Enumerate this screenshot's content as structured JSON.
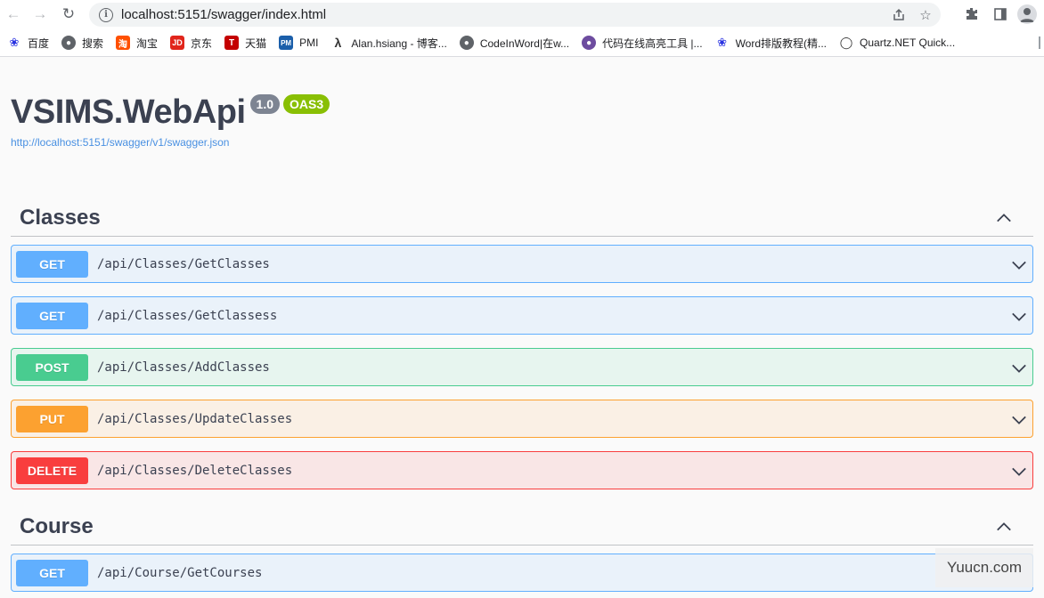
{
  "browser": {
    "url": "localhost:5151/swagger/index.html",
    "bookmarks": [
      {
        "label": "百度",
        "icon": "paw-icon",
        "color": "#2932e1"
      },
      {
        "label": "搜索",
        "icon": "globe-icon",
        "color": "#5f6368"
      },
      {
        "label": "淘宝",
        "icon": "taobao-icon",
        "color": "#ff5000"
      },
      {
        "label": "京东",
        "icon": "jd-icon",
        "color": "#e1251b"
      },
      {
        "label": "天猫",
        "icon": "tmall-icon",
        "color": "#c40000"
      },
      {
        "label": "PMI",
        "icon": "pmi-icon",
        "color": "#1b5faa"
      },
      {
        "label": "Alan.hsiang - 博客...",
        "icon": "lambda-icon",
        "color": "#333333"
      },
      {
        "label": "CodeInWord|在w...",
        "icon": "globe-icon",
        "color": "#5f6368"
      },
      {
        "label": "代码在线高亮工具 |...",
        "icon": "circle-logo-icon",
        "color": "#6d4c9f"
      },
      {
        "label": "Word排版教程(精...",
        "icon": "paw-icon",
        "color": "#2932e1"
      },
      {
        "label": "Quartz.NET Quick...",
        "icon": "quartz-icon",
        "color": "#333333"
      }
    ]
  },
  "swagger": {
    "title": "VSIMS.WebApi",
    "version": "1.0",
    "oas": "OAS3",
    "spec_url": "http://localhost:5151/swagger/v1/swagger.json",
    "tags": [
      {
        "name": "Classes",
        "operations": [
          {
            "method": "GET",
            "path": "/api/Classes/GetClasses"
          },
          {
            "method": "GET",
            "path": "/api/Classes/GetClassess"
          },
          {
            "method": "POST",
            "path": "/api/Classes/AddClasses"
          },
          {
            "method": "PUT",
            "path": "/api/Classes/UpdateClasses"
          },
          {
            "method": "DELETE",
            "path": "/api/Classes/DeleteClasses"
          }
        ]
      },
      {
        "name": "Course",
        "operations": [
          {
            "method": "GET",
            "path": "/api/Course/GetCourses"
          }
        ]
      }
    ]
  },
  "watermark": "Yuucn.com"
}
